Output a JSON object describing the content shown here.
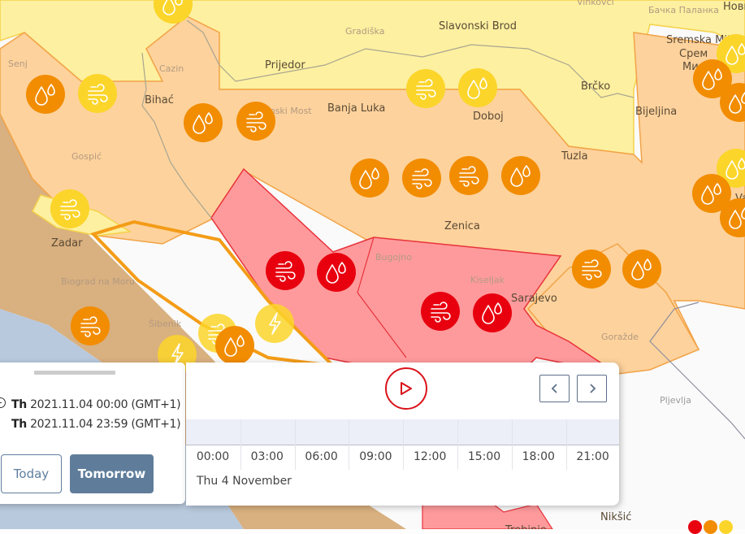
{
  "map": {
    "colors": {
      "red_warning": "#e8000f",
      "orange_warning": "#f28c00",
      "yellow_warning": "#fbd52a",
      "red_zone_fill": "#fe9a9c",
      "orange_zone_fill": "#fdd29c",
      "yellow_zone_fill": "#fdf0a0",
      "sea": "#b8c9dd",
      "coast_zone": "#d9b07f"
    },
    "cities": [
      {
        "name": "Slavonski Brod",
        "style": "normal"
      },
      {
        "name": "Gradiška",
        "style": "faded"
      },
      {
        "name": "Vinkovci",
        "style": "faded"
      },
      {
        "name": "Бачка Паланка",
        "style": "faded"
      },
      {
        "name": "Нови",
        "style": "normal"
      },
      {
        "name": "Sremska Mitrovica",
        "style": "normal"
      },
      {
        "name": "Срем",
        "style": "normal"
      },
      {
        "name": "Ми",
        "style": "normal"
      },
      {
        "name": "Prijedor",
        "style": "normal"
      },
      {
        "name": "Cazin",
        "style": "faded"
      },
      {
        "name": "Senj",
        "style": "faded"
      },
      {
        "name": "Bihać",
        "style": "normal"
      },
      {
        "name": "Sanski Most",
        "style": "faded"
      },
      {
        "name": "Banja Luka",
        "style": "normal"
      },
      {
        "name": "Doboj",
        "style": "normal"
      },
      {
        "name": "Brčko",
        "style": "normal"
      },
      {
        "name": "Bijeljina",
        "style": "normal"
      },
      {
        "name": "Tuzla",
        "style": "normal"
      },
      {
        "name": "Gospić",
        "style": "faded"
      },
      {
        "name": "Zenica",
        "style": "normal"
      },
      {
        "name": "Zadar",
        "style": "normal"
      },
      {
        "name": "Bugojno",
        "style": "faded"
      },
      {
        "name": "Kiseljak",
        "style": "faded"
      },
      {
        "name": "Sarajevo",
        "style": "normal"
      },
      {
        "name": "Biograd na Moru",
        "style": "faded"
      },
      {
        "name": "Šibenik",
        "style": "faded"
      },
      {
        "name": "Goražde",
        "style": "faded"
      },
      {
        "name": "Pljevlja",
        "style": "gray"
      },
      {
        "name": "Nikšić",
        "style": "normal"
      },
      {
        "name": "Trebinje",
        "style": "normal"
      },
      {
        "name": "Va",
        "style": "normal"
      }
    ],
    "warning_markers": [
      {
        "type": "rain",
        "level": "orange"
      },
      {
        "type": "wind",
        "level": "yellow"
      },
      {
        "type": "rain",
        "level": "orange"
      },
      {
        "type": "wind",
        "level": "orange"
      },
      {
        "type": "rain",
        "level": "yellow"
      },
      {
        "type": "wind",
        "level": "yellow"
      },
      {
        "type": "rain",
        "level": "yellow"
      },
      {
        "type": "rain",
        "level": "orange"
      },
      {
        "type": "wind",
        "level": "orange"
      },
      {
        "type": "wind",
        "level": "orange"
      },
      {
        "type": "rain",
        "level": "orange"
      },
      {
        "type": "wind",
        "level": "yellow"
      },
      {
        "type": "wind",
        "level": "red"
      },
      {
        "type": "rain",
        "level": "red"
      },
      {
        "type": "wind",
        "level": "red"
      },
      {
        "type": "rain",
        "level": "red"
      },
      {
        "type": "wind",
        "level": "orange"
      },
      {
        "type": "rain",
        "level": "orange"
      },
      {
        "type": "wind",
        "level": "orange"
      },
      {
        "type": "wind",
        "level": "yellow"
      },
      {
        "type": "thunderstorm",
        "level": "yellow"
      },
      {
        "type": "thunderstorm",
        "level": "yellow"
      },
      {
        "type": "rain",
        "level": "orange"
      },
      {
        "type": "rain",
        "level": "yellow"
      },
      {
        "type": "rain",
        "level": "orange"
      },
      {
        "type": "rain",
        "level": "orange"
      },
      {
        "type": "rain",
        "level": "yellow"
      },
      {
        "type": "rain",
        "level": "orange"
      },
      {
        "type": "rain",
        "level": "orange"
      }
    ],
    "legend_levels": [
      "red",
      "orange",
      "yellow"
    ]
  },
  "date_panel": {
    "from_day": "Th",
    "from_datetime": "2021.11.04 00:00 (GMT+1)",
    "to_day": "Th",
    "to_datetime": "2021.11.04 23:59 (GMT+1)",
    "today_label": "Today",
    "tomorrow_label": "Tomorrow",
    "icon": "clock-icon"
  },
  "timeline": {
    "play_icon": "play-icon",
    "prev_icon": "chevron-left-icon",
    "next_icon": "chevron-right-icon",
    "hours": [
      "00:00",
      "03:00",
      "06:00",
      "09:00",
      "12:00",
      "15:00",
      "18:00",
      "21:00"
    ],
    "day_label": "Thu 4 November",
    "accent_color": "#d9131b"
  }
}
